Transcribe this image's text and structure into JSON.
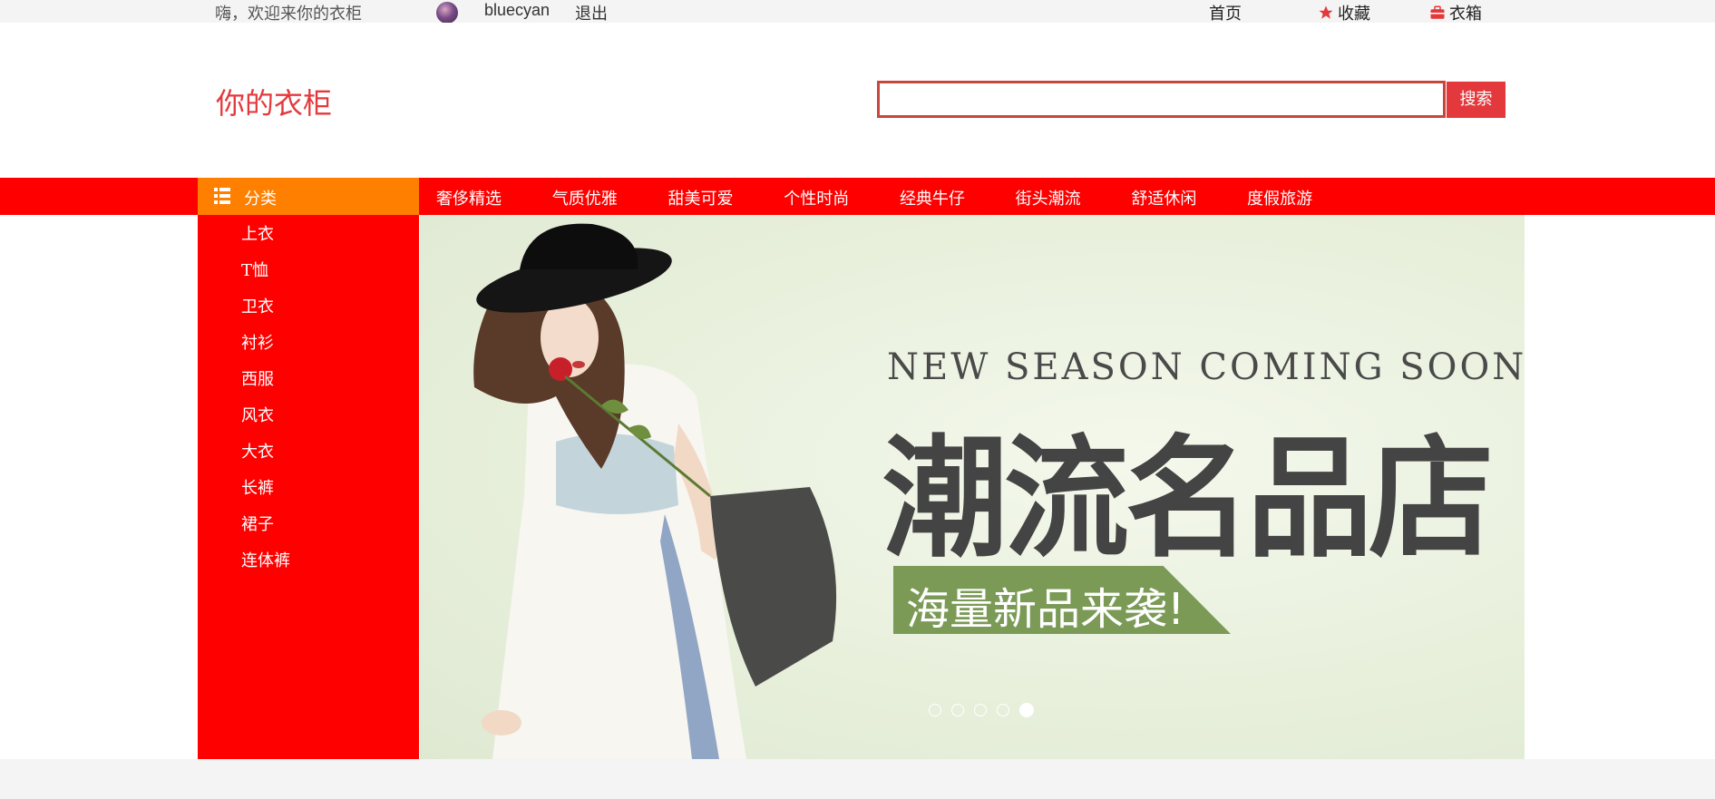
{
  "topbar": {
    "greeting": "嗨，欢迎来你的衣柜",
    "username": "bluecyan",
    "logout": "退出",
    "home": "首页",
    "favorites": "收藏",
    "closet": "衣箱"
  },
  "header": {
    "logo": "你的衣柜",
    "search_value": "",
    "search_button": "搜索"
  },
  "nav": {
    "category_label": "分类",
    "items": [
      "奢侈精选",
      "气质优雅",
      "甜美可爱",
      "个性时尚",
      "经典牛仔",
      "街头潮流",
      "舒适休闲",
      "度假旅游"
    ]
  },
  "sidebar": {
    "items": [
      "上衣",
      "T恤",
      "卫衣",
      "衬衫",
      "西服",
      "风衣",
      "大衣",
      "长裤",
      "裙子",
      "连体裤"
    ]
  },
  "banner": {
    "kicker": "NEW SEASON COMING SOON",
    "headline": "潮流名品店",
    "tag": "海量新品来袭!",
    "slide_count": 5,
    "active_slide": 5
  },
  "colors": {
    "brand_red": "#ff0000",
    "category_orange": "#ff7f00",
    "search_border": "#c9463d",
    "tag_green": "#7a9a56"
  }
}
